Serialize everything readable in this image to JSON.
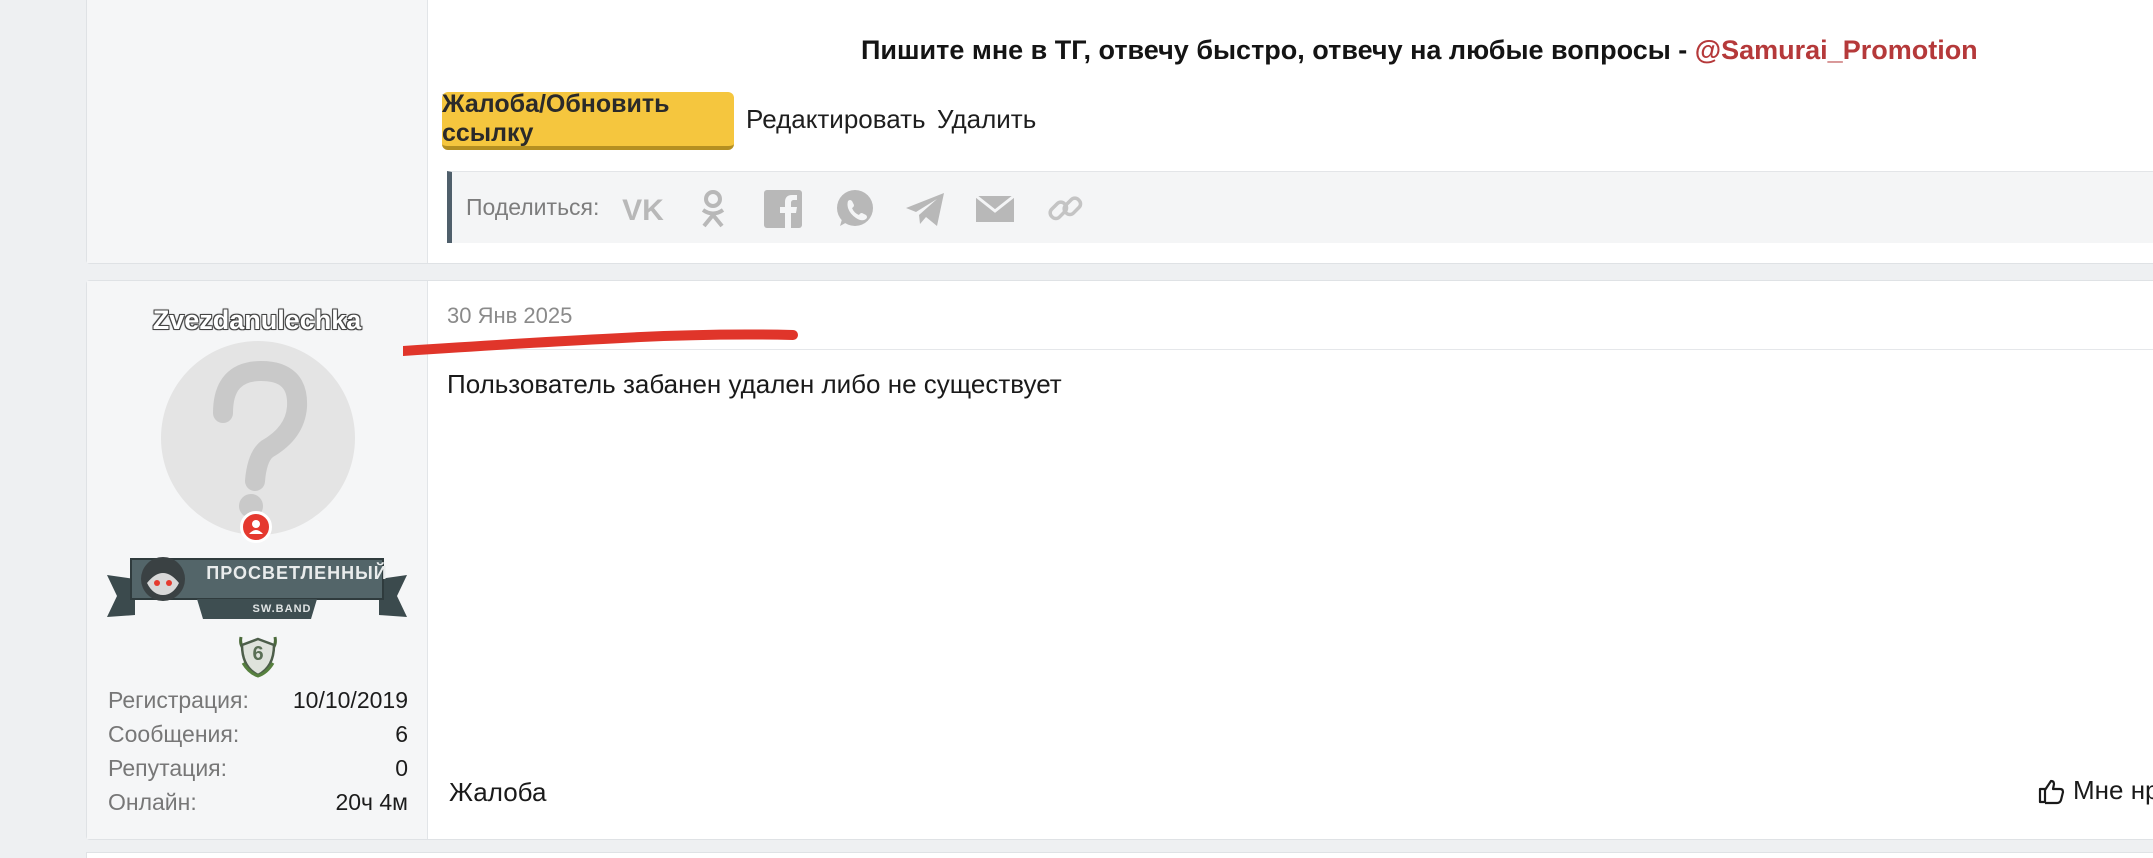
{
  "post1": {
    "promo_text": "Пишите мне в ТГ, отвечу быстро, отвечу на любые вопросы - ",
    "promo_handle": "@Samurai_Promotion",
    "actions": {
      "report_update": "Жалоба/Обновить ссылку",
      "edit": "Редактировать",
      "delete": "Удалить"
    },
    "share": {
      "label": "Поделиться:",
      "icons": [
        "vk-icon",
        "odnoklassniki-icon",
        "facebook-icon",
        "whatsapp-icon",
        "telegram-icon",
        "email-icon",
        "link-icon"
      ]
    }
  },
  "post2": {
    "author": {
      "username": "Zvezdanulechka",
      "rank_title": "ПРОСВЕТЛЕННЫЙ",
      "rank_sub": "SW.BAND",
      "level": "6",
      "stats": [
        {
          "label": "Регистрация:",
          "value": "10/10/2019"
        },
        {
          "label": "Сообщения:",
          "value": "6"
        },
        {
          "label": "Репутация:",
          "value": "0"
        },
        {
          "label": "Онлайн:",
          "value": "20ч 4м"
        }
      ]
    },
    "date": "30 Янв 2025",
    "message": "Пользователь забанен удален либо не существует",
    "report": "Жалоба",
    "like": "Мне нр"
  },
  "colors": {
    "accent_yellow": "#f5c63e",
    "handle_red": "#b5393a",
    "status_red": "#e5392f",
    "annotation_red": "#e0352a"
  }
}
